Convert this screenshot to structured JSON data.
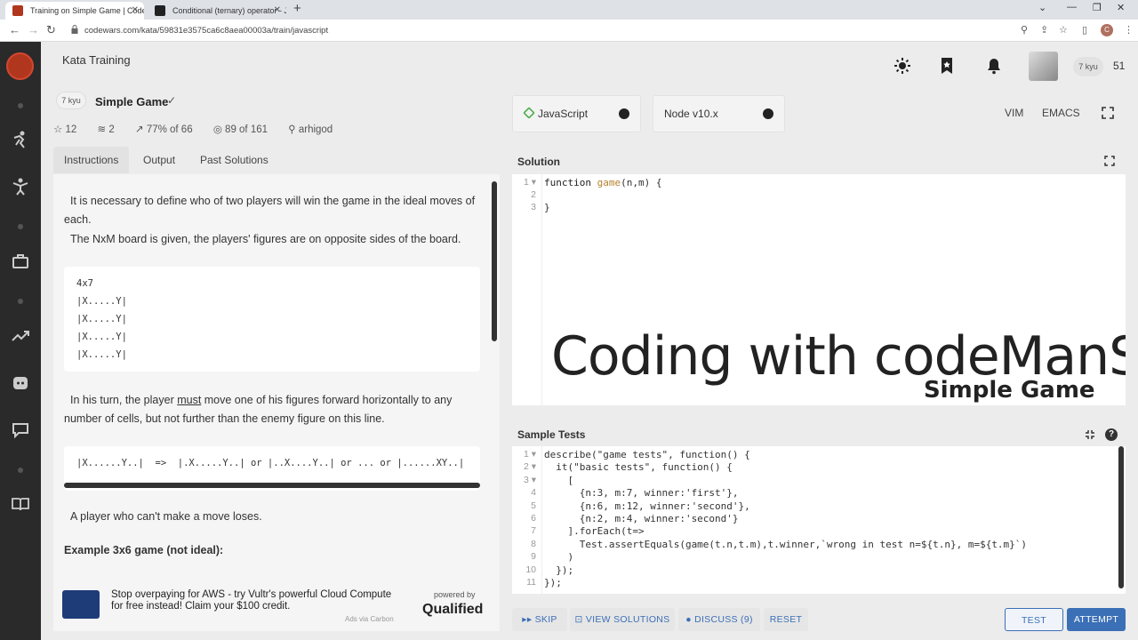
{
  "browser": {
    "tabs": [
      {
        "title": "Training on Simple Game | Codewars",
        "active": true
      },
      {
        "title": "Conditional (ternary) operator - JavaScript | MDN",
        "active": false
      }
    ],
    "url": "codewars.com/kata/59831e3575ca6c8aea00003a/train/javascript"
  },
  "header": {
    "section": "Kata Training",
    "rank": "7 kyu",
    "honor": "51"
  },
  "kata": {
    "kyu": "7 kyu",
    "title": "Simple Game",
    "stats": {
      "stars": "12",
      "collections": "2",
      "satisfaction": "77% of 66",
      "completions": "89 of 161",
      "author": "arhigod"
    }
  },
  "left_tabs": [
    "Instructions",
    "Output",
    "Past Solutions"
  ],
  "instructions": {
    "p1": "It is necessary to define who of two players will win the game in the ideal moves of each.",
    "p2": "The NxM board is given, the players' figures are on opposite sides of the board.",
    "board": [
      "4x7",
      "|X.....Y|",
      "|X.....Y|",
      "|X.....Y|",
      "|X.....Y|"
    ],
    "p3_before": "In his turn, the player ",
    "p3_must": "must",
    "p3_after": " move one of his figures forward horizontally to any number of cells, but not further than the enemy figure on this line.",
    "moves": "|X......Y..|  =>  |.X.....Y..| or |..X....Y..| or ... or |......XY..|",
    "p4": "A player who can't make a move loses.",
    "example_heading": "Example 3x6 game (not ideal):"
  },
  "ad": {
    "text": "Stop overpaying for AWS - try Vultr's powerful Cloud Compute for free instead! Claim your $100 credit.",
    "via": "Ads via Carbon",
    "powered": "powered by",
    "brand": "Qualified"
  },
  "editor": {
    "language": "JavaScript",
    "runtime": "Node v10.x",
    "modes": [
      "VIM",
      "EMACS"
    ],
    "solution_label": "Solution",
    "solution_lines": [
      "function game(n,m) {",
      "",
      "}"
    ],
    "watermark": "Coding with codeManS",
    "watermark_sub": "Simple Game",
    "tests_label": "Sample Tests",
    "test_lines": [
      "describe(\"game tests\", function() {",
      "  it(\"basic tests\", function() {",
      "    [",
      "      {n:3, m:7, winner:'first'},",
      "      {n:6, m:12, winner:'second'},",
      "      {n:2, m:4, winner:'second'}",
      "    ].forEach(t=>",
      "      Test.assertEquals(game(t.n,t.m),t.winner,`wrong in test n=${t.n}, m=${t.m}`)",
      "    )",
      "  });",
      "});"
    ]
  },
  "buttons": {
    "skip": "SKIP",
    "view_solutions": "VIEW SOLUTIONS",
    "discuss": "DISCUSS (9)",
    "reset": "RESET",
    "test": "TEST",
    "attempt": "ATTEMPT"
  },
  "colors": {
    "brand": "#b1361e",
    "accent": "#3b6fb6",
    "nav_bg": "#2a2a2a"
  }
}
